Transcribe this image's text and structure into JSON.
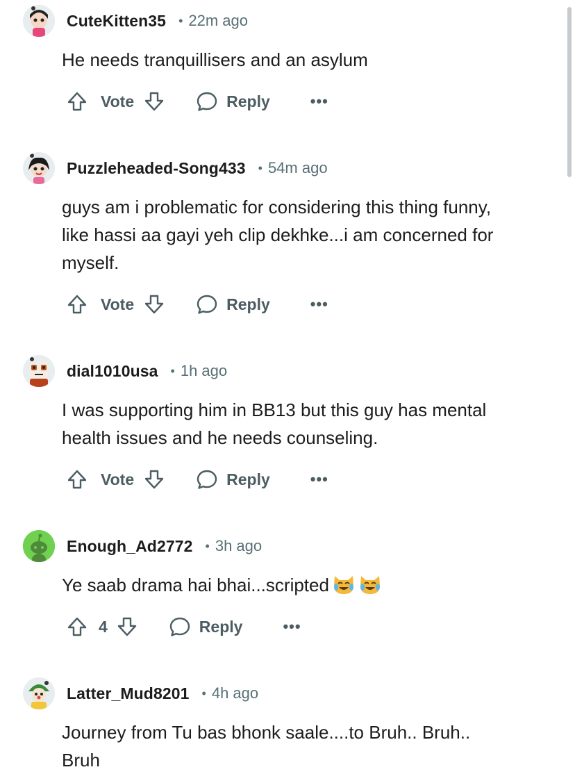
{
  "comments": [
    {
      "author": "CuteKitten35",
      "dot": "•",
      "time": "22m ago",
      "lines": [
        "He needs tranquillisers and an asylum"
      ],
      "vote": "Vote",
      "reply": "Reply",
      "more": "•••"
    },
    {
      "author": "Puzzleheaded-Song433",
      "dot": "•",
      "time": "54m ago",
      "lines": [
        "guys am i problematic for considering this thing funny,",
        "like hassi aa gayi yeh clip dekhke...i am concerned for",
        "myself."
      ],
      "vote": "Vote",
      "reply": "Reply",
      "more": "•••"
    },
    {
      "author": "dial1010usa",
      "dot": "•",
      "time": "1h ago",
      "lines": [
        "I was supporting him in BB13 but this guy has mental",
        "health issues and he needs counseling."
      ],
      "vote": "Vote",
      "reply": "Reply",
      "more": "•••"
    },
    {
      "author": "Enough_Ad2772",
      "dot": "•",
      "time": "3h ago",
      "lines": [
        "Ye saab drama hai bhai...scripted"
      ],
      "emojis": [
        "crying-laughing-cat-emoji",
        "crying-laughing-cat-emoji"
      ],
      "vote": "4",
      "reply": "Reply",
      "more": "•••"
    },
    {
      "author": "Latter_Mud8201",
      "dot": "•",
      "time": "4h ago",
      "lines": [
        "Journey from Tu bas bhonk saale....to Bruh.. Bruh..",
        "Bruh"
      ]
    }
  ],
  "icons": {
    "upvote": "arrow-up-outline-icon",
    "downvote": "arrow-down-outline-icon",
    "reply": "speech-bubble-icon",
    "more": "more-dots-icon"
  },
  "colors": {
    "text": "#1c1c1c",
    "meta": "#576f76",
    "action": "#4b5c63"
  }
}
